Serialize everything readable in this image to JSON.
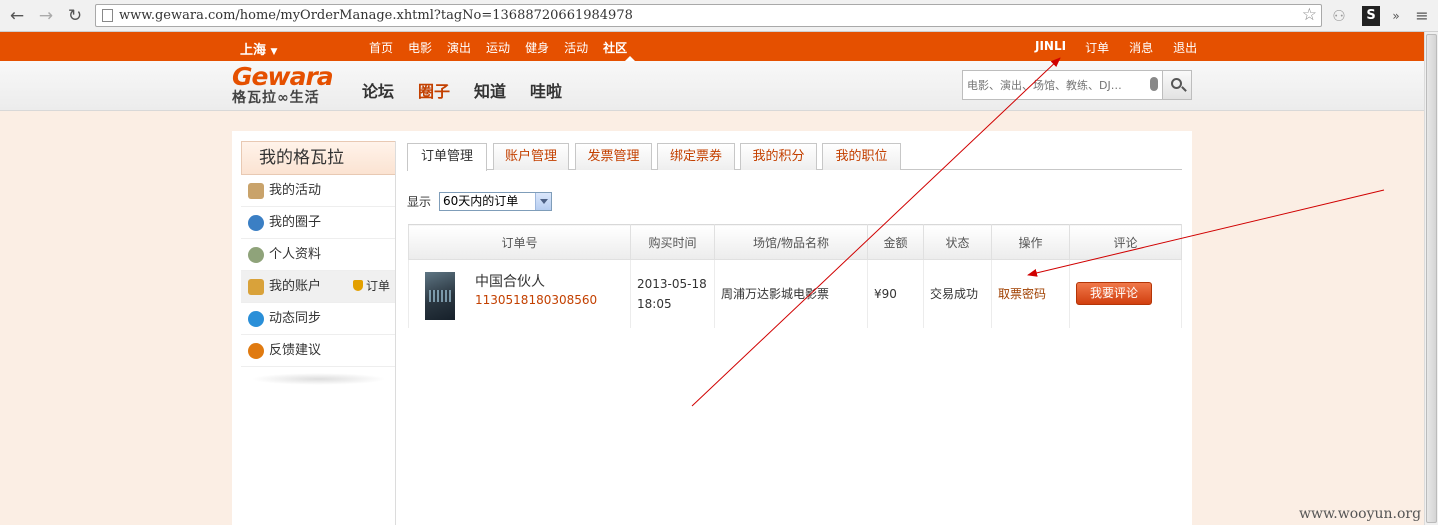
{
  "browser": {
    "url": "www.gewara.com/home/myOrderManage.xhtml?tagNo=13688720661984978",
    "s_ext": "S",
    "overflow": "»"
  },
  "topbar": {
    "city": "上海",
    "menu": [
      "首页",
      "电影",
      "演出",
      "运动",
      "健身",
      "活动",
      "社区"
    ],
    "user": {
      "name": "JINLI",
      "orders": "订单",
      "messages": "消息",
      "logout": "退出"
    }
  },
  "header": {
    "logo_wordmark": "Gewara",
    "logo_subtitle": "格瓦拉∞生活",
    "nav": [
      "论坛",
      "圈子",
      "知道",
      "哇啦"
    ],
    "search_placeholder": "电影、演出、场馆、教练、DJ…"
  },
  "sidebar": {
    "title": "我的格瓦拉",
    "items": [
      {
        "label": "我的活动",
        "icon_color": "#c9a36b"
      },
      {
        "label": "我的圈子",
        "icon_color": "#3b7fc4"
      },
      {
        "label": "个人资料",
        "icon_color": "#8fa37a"
      },
      {
        "label": "我的账户",
        "icon_color": "#d9a23a",
        "sub": "订单"
      },
      {
        "label": "动态同步",
        "icon_color": "#2a8fd8"
      },
      {
        "label": "反馈建议",
        "icon_color": "#e07a10"
      }
    ]
  },
  "tabs": [
    "订单管理",
    "账户管理",
    "发票管理",
    "绑定票券",
    "我的积分",
    "我的职位"
  ],
  "filter": {
    "label": "显示",
    "selected": "60天内的订单"
  },
  "table": {
    "headers": [
      "订单号",
      "购买时间",
      "场馆/物品名称",
      "金额",
      "状态",
      "操作",
      "评论"
    ],
    "rows": [
      {
        "film": "中国合伙人",
        "order_id": "1130518180308560",
        "date": "2013-05-18",
        "time": "18:05",
        "venue": "周浦万达影城电影票",
        "amount": "¥90",
        "status": "交易成功",
        "action": "取票密码",
        "comment": "我要评论"
      }
    ]
  },
  "watermark": "www.wooyun.org",
  "colors": {
    "brand": "#e55000",
    "link": "#c34000",
    "annotation": "#d00000"
  }
}
